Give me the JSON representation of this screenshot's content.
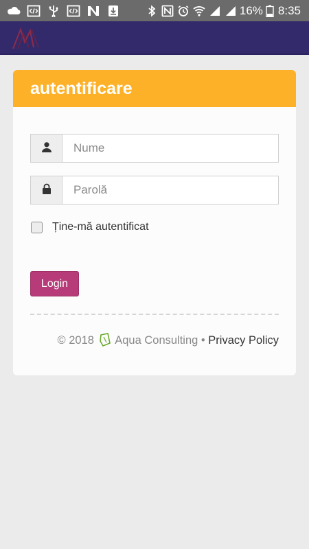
{
  "status_bar": {
    "left_icons": [
      "cloud-icon",
      "code-icon",
      "usb-icon",
      "code-icon",
      "n-logo-icon",
      "download-icon"
    ],
    "right_icons": [
      "bluetooth-icon",
      "nfc-icon",
      "alarm-icon",
      "wifi-icon",
      "signal-icon",
      "signal-icon",
      "battery-icon"
    ],
    "battery": "16%",
    "time": "8:35"
  },
  "app_bar": {
    "logo_icon": "app-logo-icon",
    "color": "#332a6b"
  },
  "login_card": {
    "title": "autentificare",
    "header_color": "#fdb128",
    "username": {
      "placeholder": "Nume",
      "value": "",
      "icon": "user-icon"
    },
    "password": {
      "placeholder": "Parolă",
      "value": "",
      "icon": "lock-icon"
    },
    "remember_me": {
      "label": "Ține-mă autentificat",
      "checked": false
    },
    "login_button": {
      "label": "Login",
      "color": "#b73b78"
    }
  },
  "footer": {
    "copyright": "© 2018",
    "company": "Aqua Consulting",
    "separator": "•",
    "privacy": "Privacy Policy",
    "leaf_icon": "leaf-icon"
  }
}
